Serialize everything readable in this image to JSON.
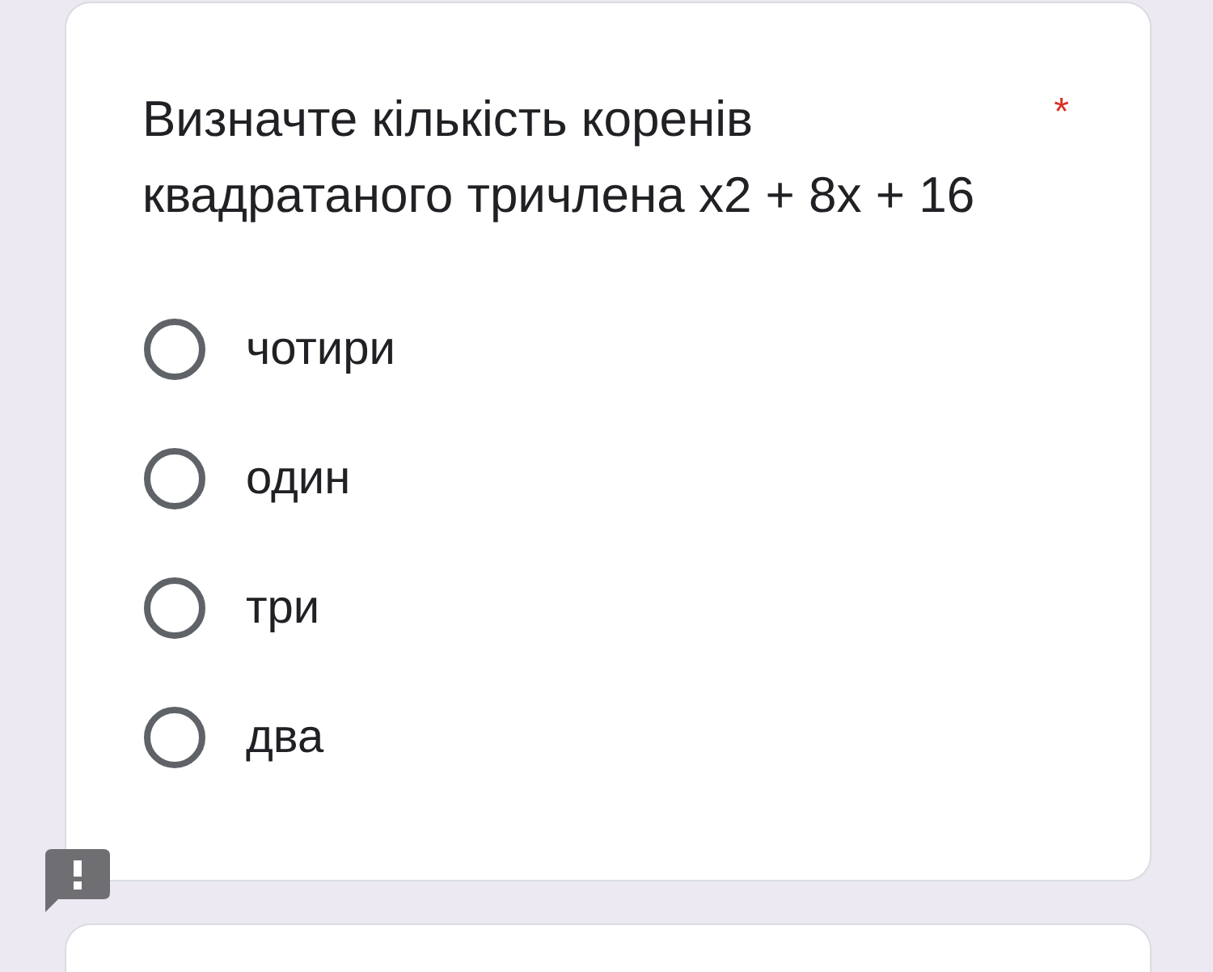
{
  "question": {
    "text": "Визначте кількість коренів квадратаного тричлена x2 + 8x + 16",
    "required_mark": "*"
  },
  "options": [
    {
      "label": "чотири",
      "selected": false
    },
    {
      "label": "один",
      "selected": false
    },
    {
      "label": "три",
      "selected": false
    },
    {
      "label": "два",
      "selected": false
    }
  ]
}
